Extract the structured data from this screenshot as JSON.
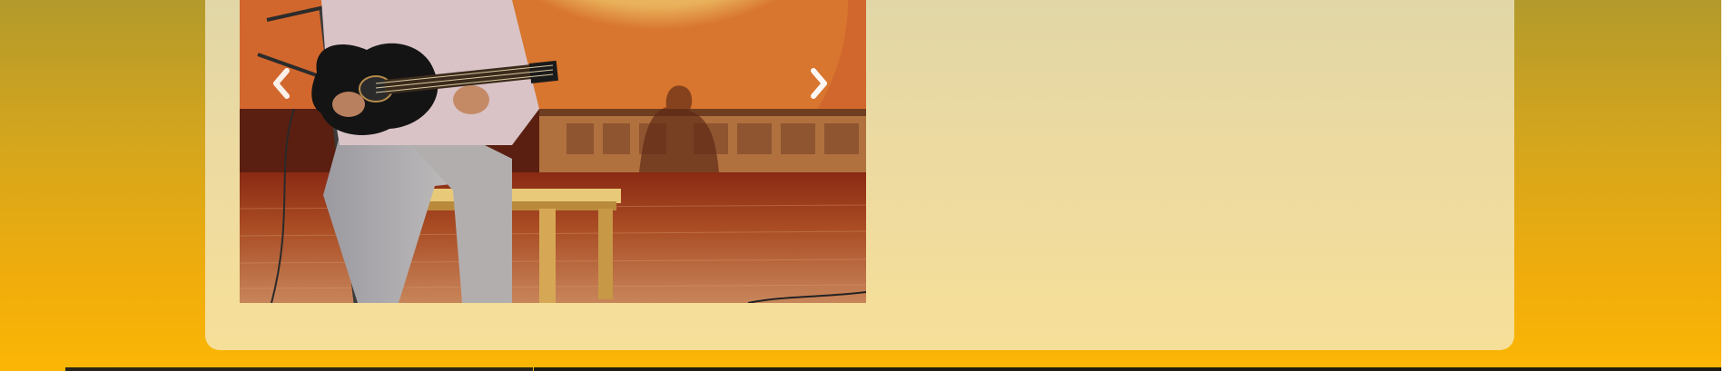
{
  "page": {
    "background_top": "#b39a2c",
    "background_bottom": "#fbb604",
    "panel_color": "#f6df98"
  },
  "carousel": {
    "image_subject": "guitarist-performing-on-stage",
    "prev_icon": "chevron-left-icon",
    "next_icon": "chevron-right-icon",
    "arrow_color": "#ffffff"
  }
}
